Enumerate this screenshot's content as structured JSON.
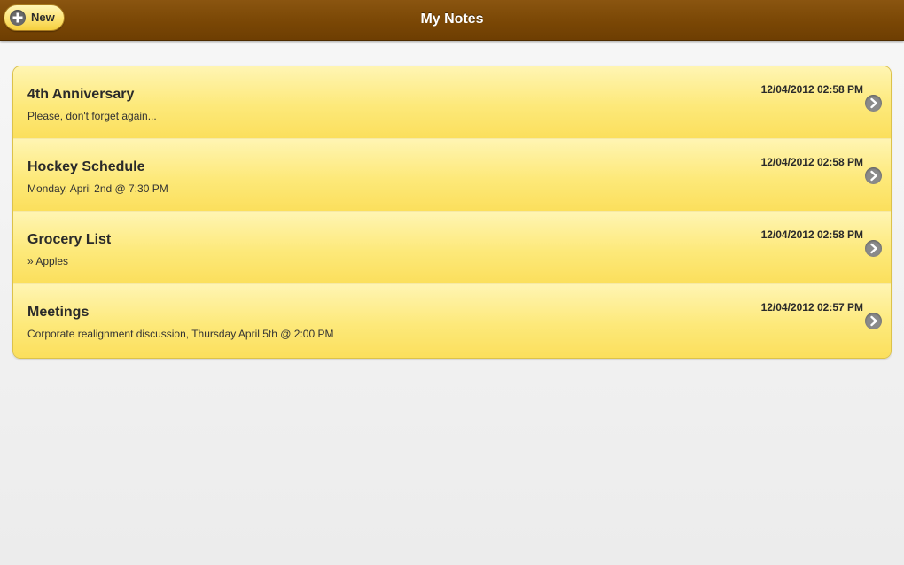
{
  "header": {
    "title": "My Notes",
    "new_label": "New",
    "new_icon": "plus-circle-icon"
  },
  "notes": [
    {
      "title": "4th Anniversary",
      "snippet": "Please, don't forget again...",
      "date": "12/04/2012 02:58 PM",
      "icon": "chevron-right-circle-icon"
    },
    {
      "title": "Hockey Schedule",
      "snippet": "Monday, April 2nd @ 7:30 PM",
      "date": "12/04/2012 02:58 PM",
      "icon": "chevron-right-circle-icon"
    },
    {
      "title": "Grocery List",
      "snippet": "» Apples",
      "date": "12/04/2012 02:58 PM",
      "icon": "chevron-right-circle-icon"
    },
    {
      "title": "Meetings",
      "snippet": "Corporate realignment discussion, Thursday April 5th @ 2:00 PM",
      "date": "12/04/2012 02:57 PM",
      "icon": "chevron-right-circle-icon"
    }
  ],
  "colors": {
    "header_brown": "#7a4705",
    "note_yellow": "#fde97a",
    "button_yellow": "#fde372"
  }
}
